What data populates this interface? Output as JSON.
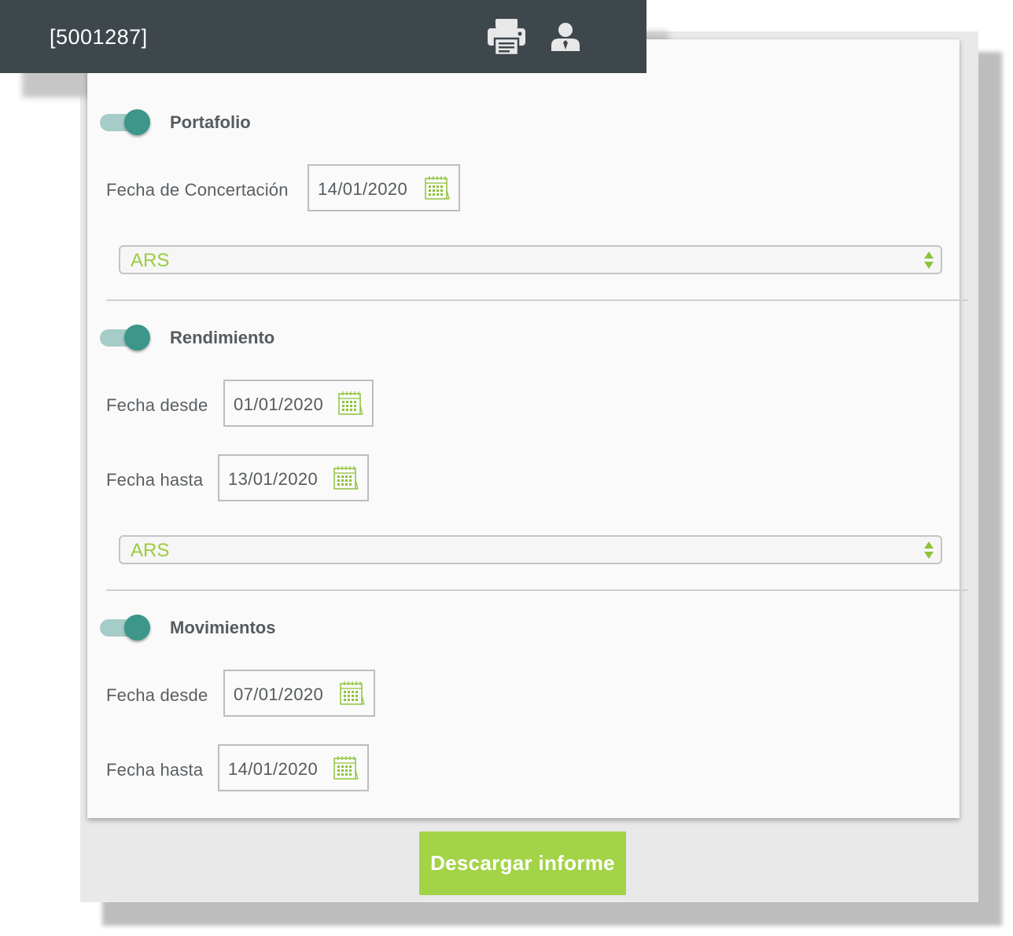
{
  "header": {
    "title": "[5001287]",
    "print_icon": "printer-icon",
    "user_icon": "user-icon"
  },
  "colors": {
    "accent_green": "#a3d347",
    "toggle_on": "#3c968a",
    "header_bg": "#3e474c",
    "select_text": "#9acc3c"
  },
  "portafolio": {
    "title": "Portafolio",
    "enabled": true,
    "fecha_label": "Fecha de Concertación",
    "fecha_value": "14/01/2020",
    "currency": "ARS"
  },
  "rendimiento": {
    "title": "Rendimiento",
    "enabled": true,
    "desde_label": "Fecha desde",
    "desde_value": "01/01/2020",
    "hasta_label": "Fecha hasta",
    "hasta_value": "13/01/2020",
    "currency": "ARS"
  },
  "movimientos": {
    "title": "Movimientos",
    "enabled": true,
    "desde_label": "Fecha desde",
    "desde_value": "07/01/2020",
    "hasta_label": "Fecha hasta",
    "hasta_value": "14/01/2020"
  },
  "actions": {
    "download_label": "Descargar informe"
  }
}
